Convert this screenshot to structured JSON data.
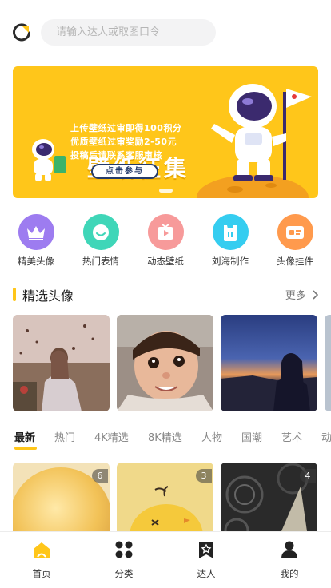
{
  "search": {
    "placeholder": "请输入达人或取图口令"
  },
  "banner": {
    "title": "壁纸征集",
    "lines": [
      "上传壁纸过审即得100积分",
      "优质壁纸过审奖励2-50元",
      "投稿后请联系客服审核"
    ],
    "button": "点击参与"
  },
  "categories": [
    {
      "label": "精美头像",
      "color": "#9d7cf0",
      "icon": "crown-icon"
    },
    {
      "label": "热门表情",
      "color": "#3fd6b8",
      "icon": "smile-icon"
    },
    {
      "label": "动态壁纸",
      "color": "#f79a9a",
      "icon": "play-icon"
    },
    {
      "label": "刘海制作",
      "color": "#35cdf0",
      "icon": "notch-icon"
    },
    {
      "label": "头像挂件",
      "color": "#ff9a4d",
      "icon": "badge-icon"
    }
  ],
  "section": {
    "title": "精选头像",
    "more": "更多"
  },
  "tabs": [
    "最新",
    "热门",
    "4K精选",
    "8K精选",
    "人物",
    "国潮",
    "艺术",
    "动漫"
  ],
  "cards": [
    {
      "badge": "6"
    },
    {
      "badge": "3"
    },
    {
      "badge": "4"
    }
  ],
  "tabbar": [
    {
      "label": "首页",
      "icon": "home-icon",
      "active": true
    },
    {
      "label": "分类",
      "icon": "grid-icon"
    },
    {
      "label": "达人",
      "icon": "star-bookmark-icon"
    },
    {
      "label": "我的",
      "icon": "person-icon"
    }
  ],
  "colors": {
    "accent": "#ffc61a",
    "navy": "#243a6b"
  }
}
